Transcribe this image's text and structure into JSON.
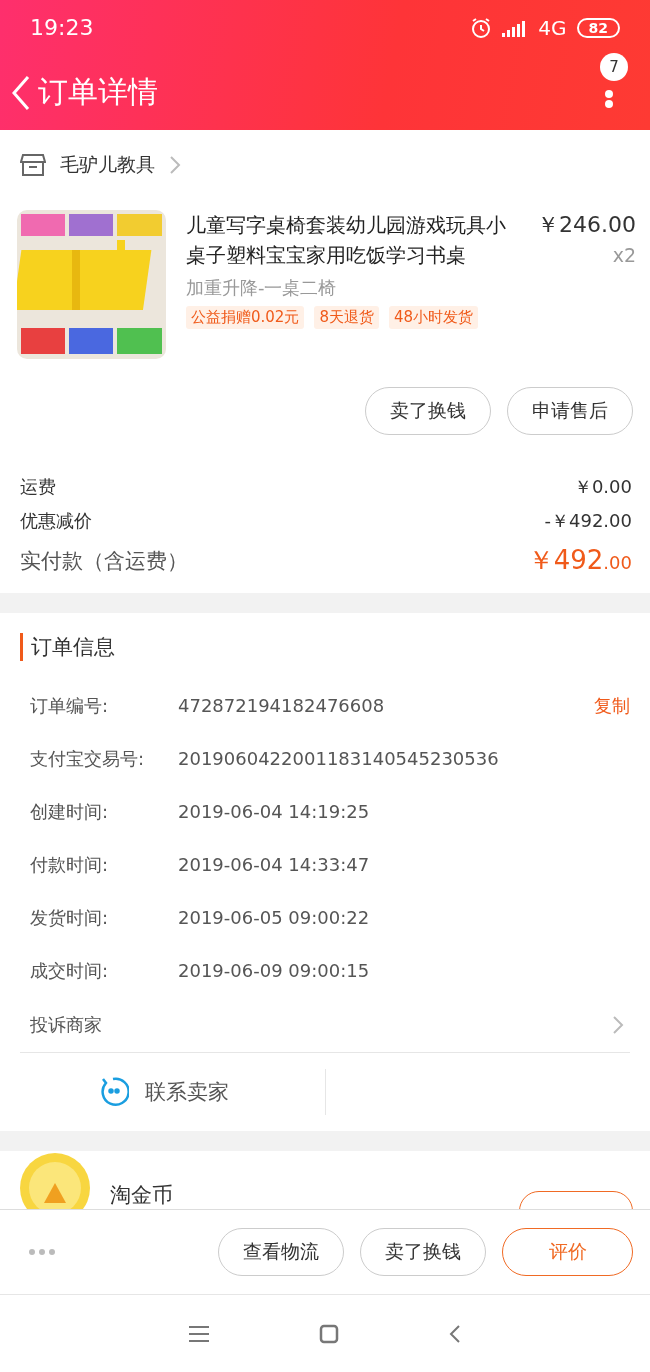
{
  "status_bar": {
    "time": "19:23",
    "network": "4G",
    "battery": "82"
  },
  "header": {
    "title": "订单详情",
    "badge": "7"
  },
  "shop": {
    "name": "毛驴儿教具"
  },
  "product": {
    "title": "儿童写字桌椅套装幼儿园游戏玩具小桌子塑料宝宝家用吃饭学习书桌",
    "variant": "加重升降-一桌二椅",
    "price": "￥246.00",
    "quantity": "x2",
    "tags": [
      "公益捐赠0.02元",
      "8天退货",
      "48小时发货"
    ]
  },
  "item_actions": [
    "卖了换钱",
    "申请售后"
  ],
  "fees": [
    {
      "label": "运费",
      "value": "￥0.00",
      "kind": "plain"
    },
    {
      "label": "优惠减价",
      "value": "-￥492.00",
      "kind": "plain"
    },
    {
      "label": "实付款（含运费）",
      "value": "￥492",
      "decimals": ".00",
      "kind": "total"
    }
  ],
  "order_info": {
    "title": "订单信息",
    "rows": [
      {
        "label": "订单编号:",
        "value": "472872194182476608",
        "action": "复制"
      },
      {
        "label": "支付宝交易号:",
        "value": "2019060422001183140545230536"
      },
      {
        "label": "创建时间:",
        "value": "2019-06-04 14:19:25"
      },
      {
        "label": "付款时间:",
        "value": "2019-06-04 14:33:47"
      },
      {
        "label": "发货时间:",
        "value": "2019-06-05 09:00:22"
      },
      {
        "label": "成交时间:",
        "value": "2019-06-09 09:00:15"
      }
    ],
    "complaint": "投诉商家"
  },
  "contact": {
    "label": "联系卖家"
  },
  "coins": {
    "title": "淘金币"
  },
  "bottom_bar": {
    "buttons": [
      {
        "label": "查看物流",
        "primary": false
      },
      {
        "label": "卖了换钱",
        "primary": false
      },
      {
        "label": "评价",
        "primary": true
      }
    ]
  }
}
